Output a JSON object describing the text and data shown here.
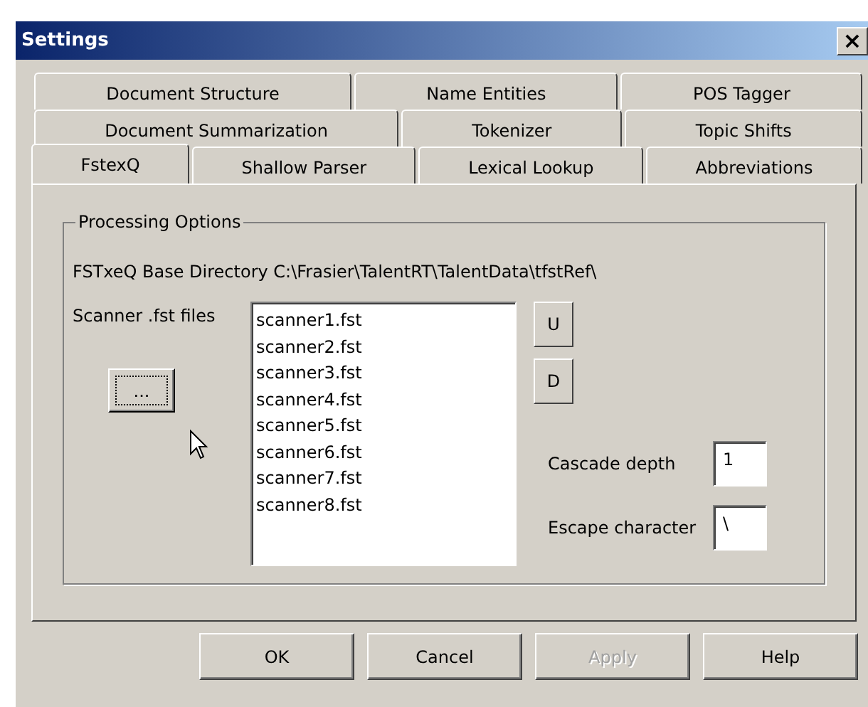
{
  "window": {
    "title": "Settings",
    "close": "×"
  },
  "tab_rows": [
    {
      "tabs": [
        {
          "label": "Document Structure",
          "selected": false
        },
        {
          "label": "Name Entities",
          "selected": false
        },
        {
          "label": "POS Tagger",
          "selected": false
        }
      ]
    },
    {
      "tabs": [
        {
          "label": "Document Summarization",
          "selected": false
        },
        {
          "label": "Tokenizer",
          "selected": false
        },
        {
          "label": "Topic Shifts",
          "selected": false
        }
      ]
    },
    {
      "tabs": [
        {
          "label": "FstexQ",
          "selected": true
        },
        {
          "label": "Shallow Parser",
          "selected": false
        },
        {
          "label": "Lexical Lookup",
          "selected": false
        },
        {
          "label": "Abbreviations",
          "selected": false
        }
      ]
    }
  ],
  "group": {
    "title": "Processing Options",
    "base_directory": "FSTxeQ Base Directory C:\\Frasier\\TalentRT\\TalentData\\tfstRef\\",
    "scanner_label": "Scanner .fst files",
    "browse_button": "...",
    "files": [
      "scanner1.fst",
      "scanner2.fst",
      "scanner3.fst",
      "scanner4.fst",
      "scanner5.fst",
      "scanner6.fst",
      "scanner7.fst",
      "scanner8.fst"
    ],
    "move_buttons": [
      "U",
      "D"
    ],
    "fields": [
      {
        "label": "Cascade depth",
        "value": "1"
      },
      {
        "label": "Escape character",
        "value": "\\"
      }
    ]
  },
  "buttons": [
    {
      "label": "OK",
      "disabled": false
    },
    {
      "label": "Cancel",
      "disabled": false
    },
    {
      "label": "Apply",
      "disabled": true
    },
    {
      "label": "Help",
      "disabled": false
    }
  ]
}
